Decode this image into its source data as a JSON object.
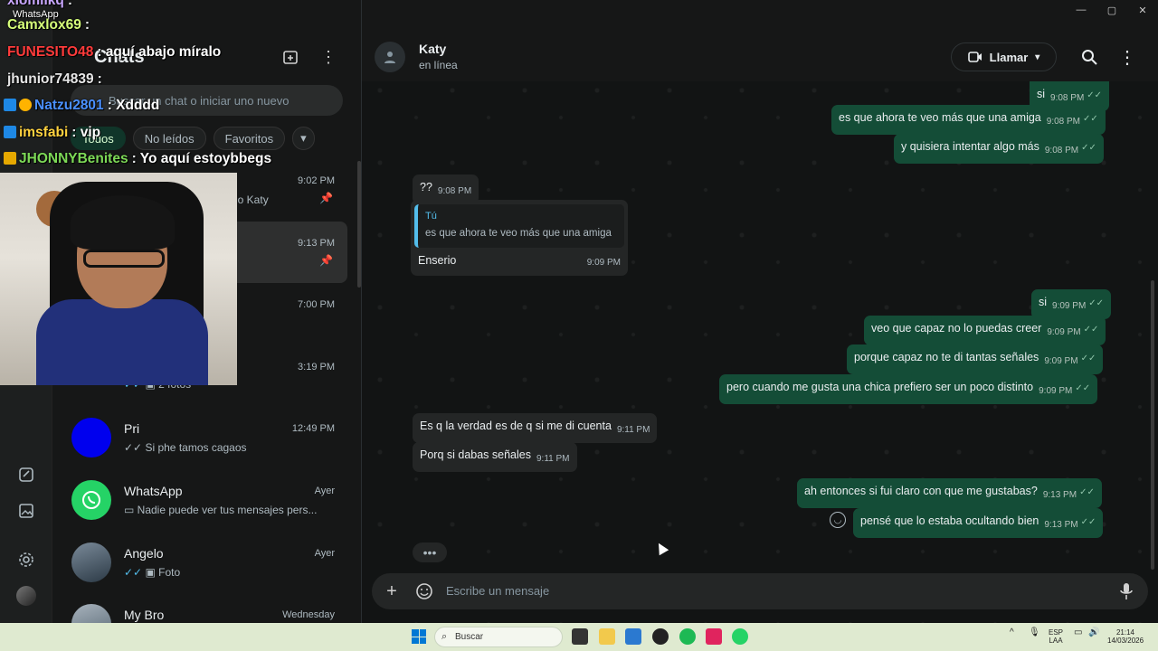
{
  "window": {
    "minimize": "—",
    "maximize": "▢",
    "close": "✕"
  },
  "sidebar_title": "Chats",
  "search": {
    "placeholder": "Buscar un chat o iniciar uno nuevo"
  },
  "filters": [
    "Todos",
    "No leídos",
    "Favoritos"
  ],
  "chats": [
    {
      "name": "",
      "preview": "no Katy",
      "time": "9:02 PM",
      "pinned": true
    },
    {
      "name": "",
      "preview": "",
      "time": "9:13 PM",
      "pinned": true
    },
    {
      "name": "",
      "preview": "",
      "time": "7:00 PM"
    },
    {
      "name": "",
      "preview": "2 fotos",
      "time": "3:19 PM"
    },
    {
      "name": "Pri",
      "preview": "Si phe tamos cagaos",
      "time": "12:49 PM",
      "avatar_color": "#0000ee"
    },
    {
      "name": "WhatsApp",
      "preview": "Nadie puede ver tus mensajes pers...",
      "time": "Ayer",
      "avatar_color": "#25d366"
    },
    {
      "name": "Angelo",
      "preview": "Foto",
      "time": "Ayer"
    },
    {
      "name": "My Bro",
      "preview": "",
      "time": "Wednesday"
    }
  ],
  "contact": {
    "name": "Katy",
    "status": "en línea"
  },
  "call_label": "Llamar",
  "messages": [
    {
      "dir": "out",
      "text": "si",
      "time": "9:08 PM"
    },
    {
      "dir": "out",
      "text": "es que ahora te veo más que una amiga",
      "time": "9:08 PM"
    },
    {
      "dir": "out",
      "text": "y quisiera intentar algo más",
      "time": "9:08 PM"
    },
    {
      "dir": "in",
      "text": "??",
      "time": "9:08 PM"
    },
    {
      "dir": "in",
      "text": "Enserio",
      "time": "9:09 PM",
      "quote_author": "Tú",
      "quote_text": "es que ahora te veo más que una amiga"
    },
    {
      "dir": "out",
      "text": "si",
      "time": "9:09 PM"
    },
    {
      "dir": "out",
      "text": "veo que capaz no lo puedas creer",
      "time": "9:09 PM"
    },
    {
      "dir": "out",
      "text": "porque capaz no te di tantas señales",
      "time": "9:09 PM"
    },
    {
      "dir": "out",
      "text": "pero cuando me gusta una chica prefiero ser un poco distinto",
      "time": "9:09 PM"
    },
    {
      "dir": "in",
      "text": "Es q la verdad es de q si me di cuenta",
      "time": "9:11 PM"
    },
    {
      "dir": "in",
      "text": "Porq si dabas señales",
      "time": "9:11 PM"
    },
    {
      "dir": "out",
      "text": "ah entonces si fui claro con que me gustabas?",
      "time": "9:13 PM"
    },
    {
      "dir": "out",
      "text": "pensé que lo estaba ocultando bien",
      "time": "9:13 PM"
    }
  ],
  "composer": {
    "placeholder": "Escribe un mensaje"
  },
  "stream_chat": [
    {
      "user": "xiomiikq",
      "text": "",
      "color": "#c9a7ff"
    },
    {
      "user": "WhatsApp",
      "text": "",
      "color": "#ffffff"
    },
    {
      "user": "Camxlox69",
      "text": "",
      "color": "#d6ff7a"
    },
    {
      "user": "FUNESITO48",
      "text": "aquí abajo míralo",
      "color": "#ff3b3b"
    },
    {
      "user": "jhunior74839",
      "text": "",
      "color": "#e6e6e6"
    },
    {
      "user": "Natzu2801",
      "text": "Xdddd",
      "color": "#4a90ff"
    },
    {
      "user": "imsfabi",
      "text": "vip",
      "color": "#ffd23f"
    },
    {
      "user": "JHONNYBenites",
      "text": "Yo aquí estoybbegs",
      "color": "#7dd957"
    }
  ],
  "taskbar": {
    "search": "Buscar",
    "lang1": "ESP",
    "lang2": "LAA",
    "clock": "21:14",
    "date": "14/03/2026"
  },
  "colors": {
    "accent": "#25d366",
    "out_bubble": "#144d37",
    "in_bubble": "#242626"
  }
}
